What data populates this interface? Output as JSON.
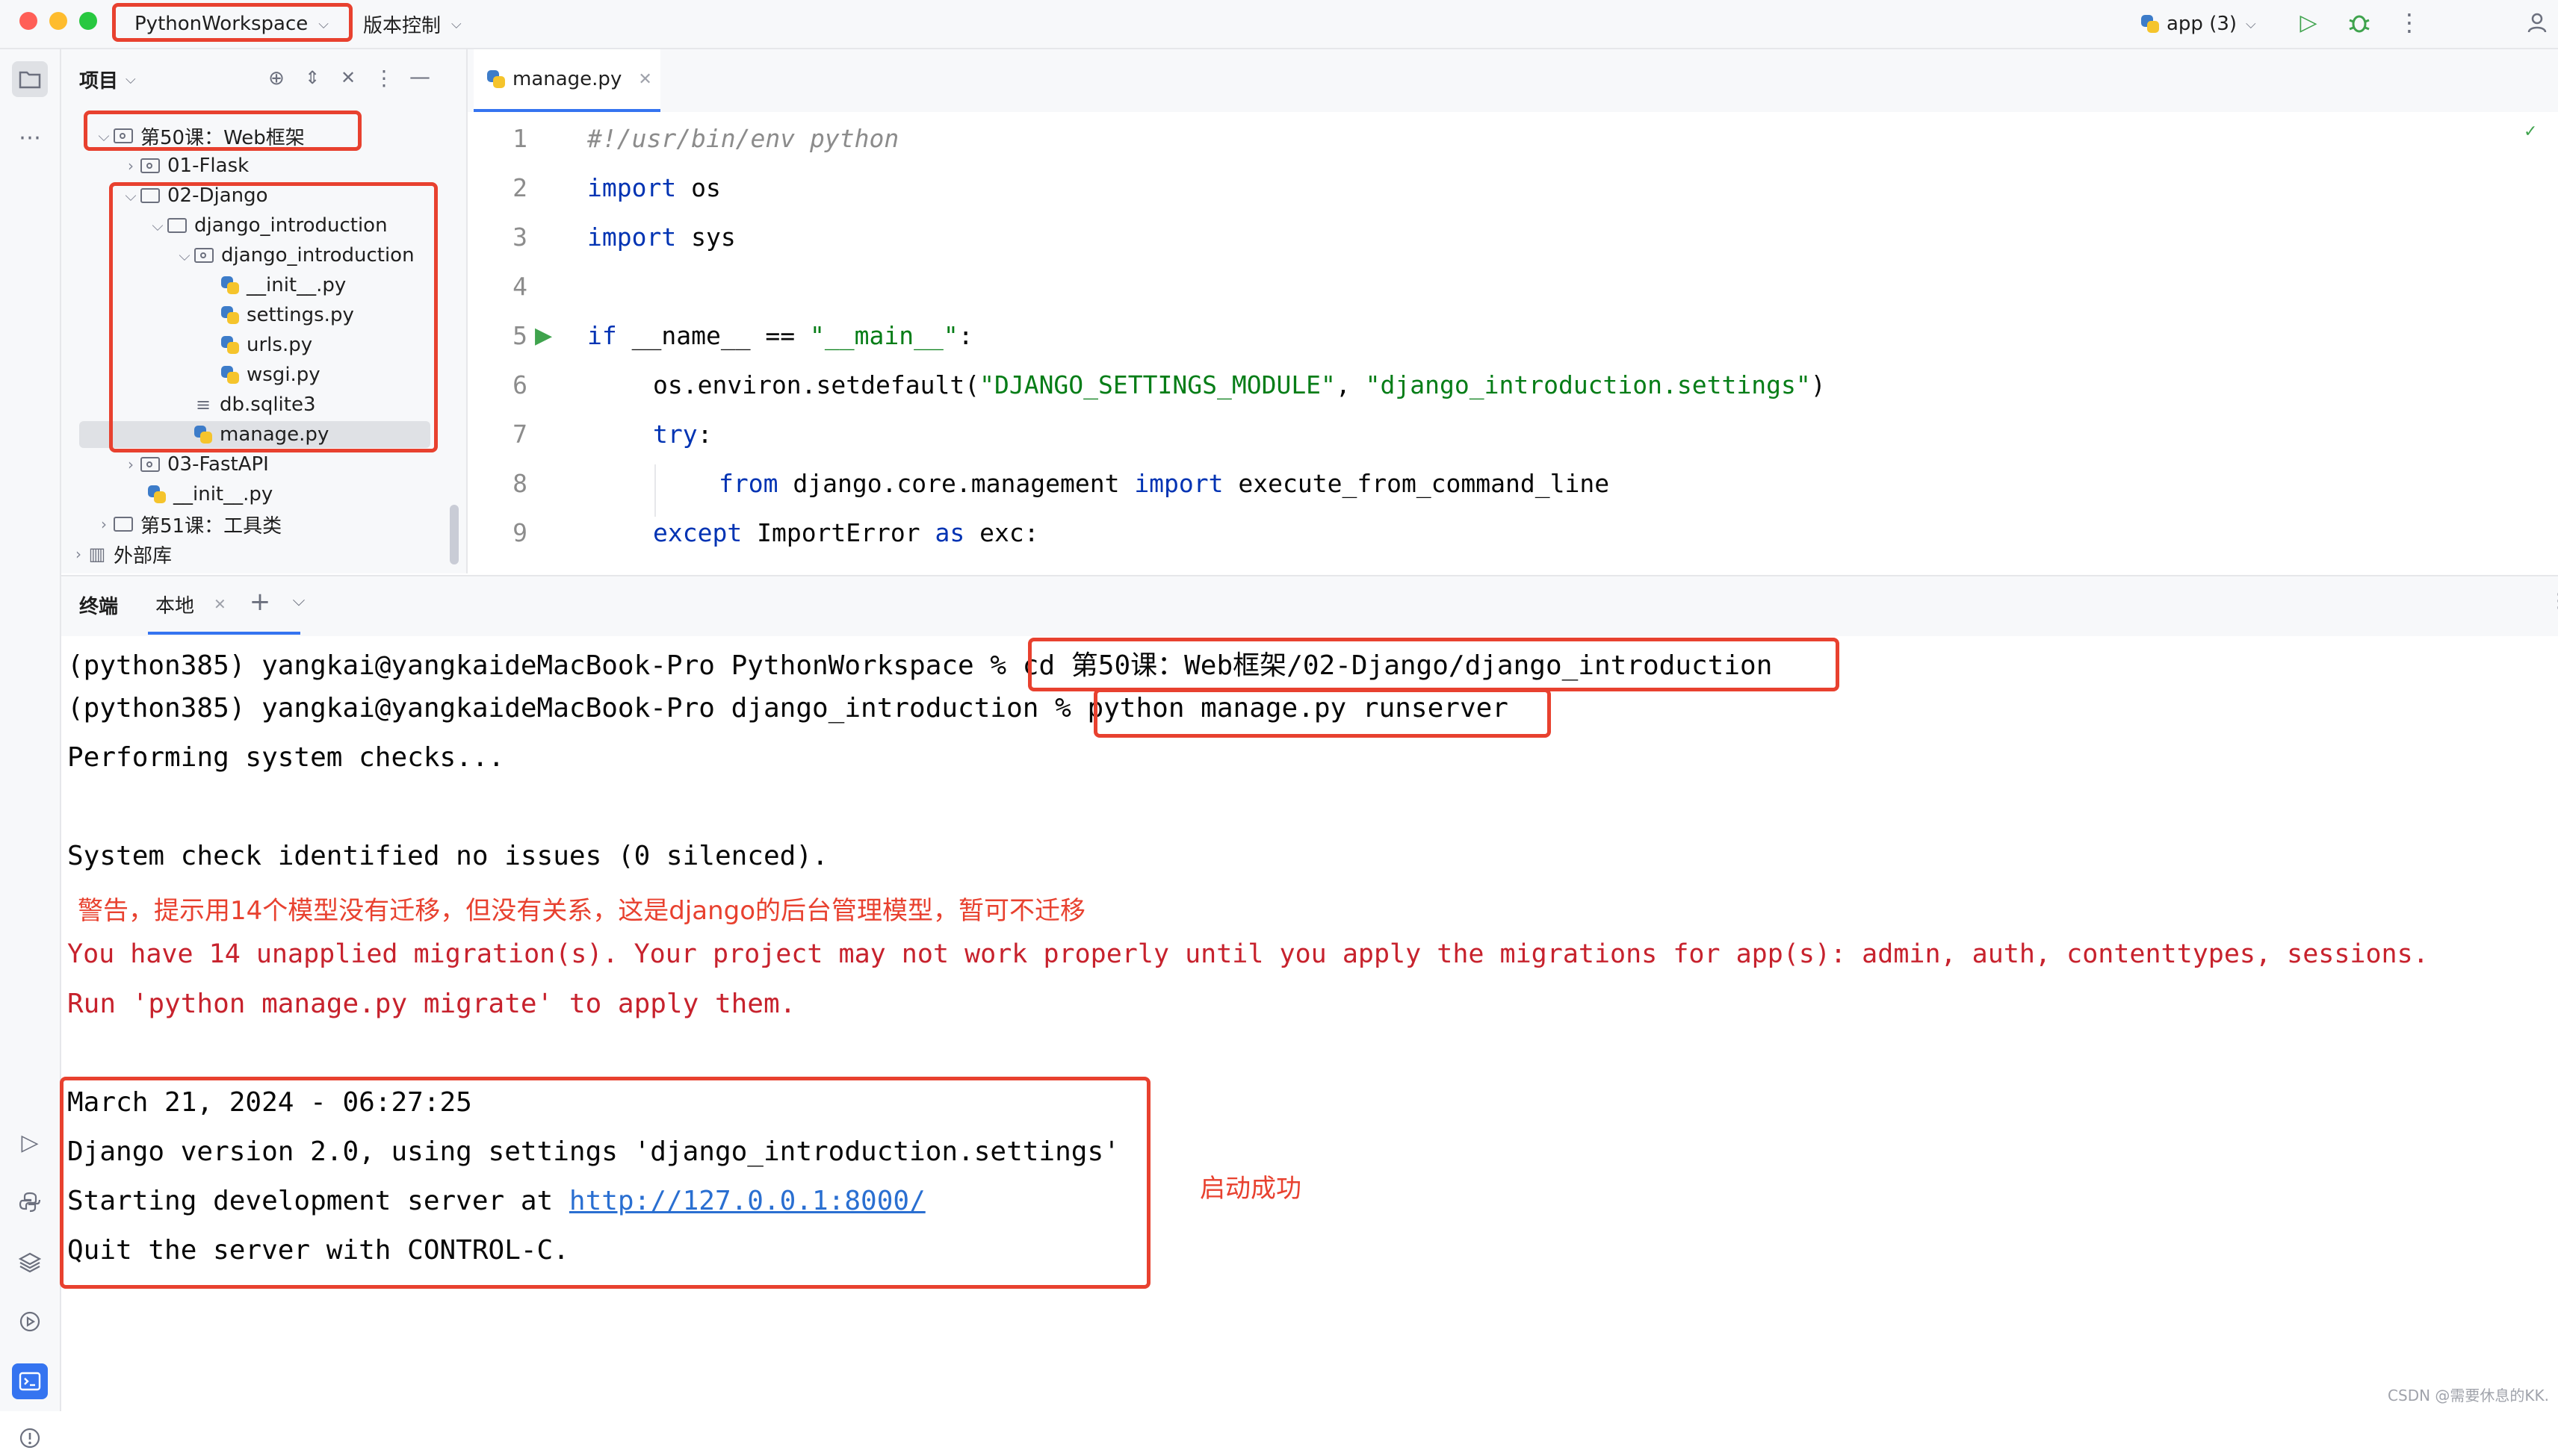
{
  "titlebar": {
    "project_name": "PythonWorkspace",
    "vcs_label": "版本控制",
    "run_config": "app (3)"
  },
  "project_panel": {
    "title": "项目",
    "items": [
      {
        "label": "第50课：Web框架",
        "type": "folder",
        "expanded": true
      },
      {
        "label": "01-Flask",
        "type": "folder",
        "expanded": false
      },
      {
        "label": "02-Django",
        "type": "folder",
        "expanded": true
      },
      {
        "label": "django_introduction",
        "type": "folder",
        "expanded": true
      },
      {
        "label": "django_introduction",
        "type": "folder",
        "expanded": true
      },
      {
        "label": "__init__.py",
        "type": "py"
      },
      {
        "label": "settings.py",
        "type": "py"
      },
      {
        "label": "urls.py",
        "type": "py"
      },
      {
        "label": "wsgi.py",
        "type": "py"
      },
      {
        "label": "db.sqlite3",
        "type": "db"
      },
      {
        "label": "manage.py",
        "type": "py",
        "selected": true
      },
      {
        "label": "03-FastAPI",
        "type": "folder",
        "expanded": false
      },
      {
        "label": "__init__.py",
        "type": "py"
      },
      {
        "label": "第51课：工具类",
        "type": "folder",
        "expanded": false
      },
      {
        "label": "外部库",
        "type": "lib",
        "expanded": false
      }
    ]
  },
  "editor": {
    "tab_label": "manage.py",
    "line_numbers": [
      "1",
      "2",
      "3",
      "4",
      "5",
      "6",
      "7",
      "8",
      "9"
    ],
    "code": {
      "l1": "#!/usr/bin/env python",
      "l2_kw": "import",
      "l2_rest": " os",
      "l3_kw": "import",
      "l3_rest": " sys",
      "l5_kw": "if",
      "l5_mid": " __name__ == ",
      "l5_str": "\"__main__\"",
      "l5_end": ":",
      "l6_a": "os.environ.setdefault(",
      "l6_s1": "\"DJANGO_SETTINGS_MODULE\"",
      "l6_b": ", ",
      "l6_s2": "\"django_introduction.settings\"",
      "l6_c": ")",
      "l7_kw": "try",
      "l7_end": ":",
      "l8_kw1": "from",
      "l8_mid": " django.core.management ",
      "l8_kw2": "import",
      "l8_end": " execute_from_command_line",
      "l9_kw": "except",
      "l9_mid": " ImportError ",
      "l9_kw2": "as",
      "l9_end": " exc:"
    }
  },
  "terminal": {
    "title": "终端",
    "tab_label": "本地",
    "line1_prompt": "(python385) yangkai@yangkaideMacBook-Pro PythonWorkspace % ",
    "line1_cmd": "cd 第50课：Web框架/02-Django/django_introduction",
    "line2_prompt": "(python385) yangkai@yangkaideMacBook-Pro django_introduction % ",
    "line2_cmd": "python manage.py runserver",
    "line3": "Performing system checks...",
    "line4": "System check identified no issues (0 silenced).",
    "line5": "You have 14 unapplied migration(s). Your project may not work properly until you apply the migrations for app(s): admin, auth, contenttypes, sessions.",
    "line6": "Run 'python manage.py migrate' to apply them.",
    "line7": "March 21, 2024 - 06:27:25",
    "line8": "Django version 2.0, using settings 'django_introduction.settings'",
    "line9_pre": "Starting development server at ",
    "line9_link": "http://127.0.0.1:8000/",
    "line10": "Quit the server with CONTROL-C."
  },
  "annotations": {
    "warning_note": "警告，提示用14个模型没有迁移，但没有关系，这是django的后台管理模型，暂可不迁移",
    "success_note": "启动成功"
  },
  "watermark": "CSDN @需要休息的KK.",
  "colors": {
    "annotation_red": "#e8412f",
    "keyword_blue": "#0033b3",
    "string_green": "#067d17",
    "error_red": "#c7222d",
    "link_blue": "#2a6fd1"
  }
}
